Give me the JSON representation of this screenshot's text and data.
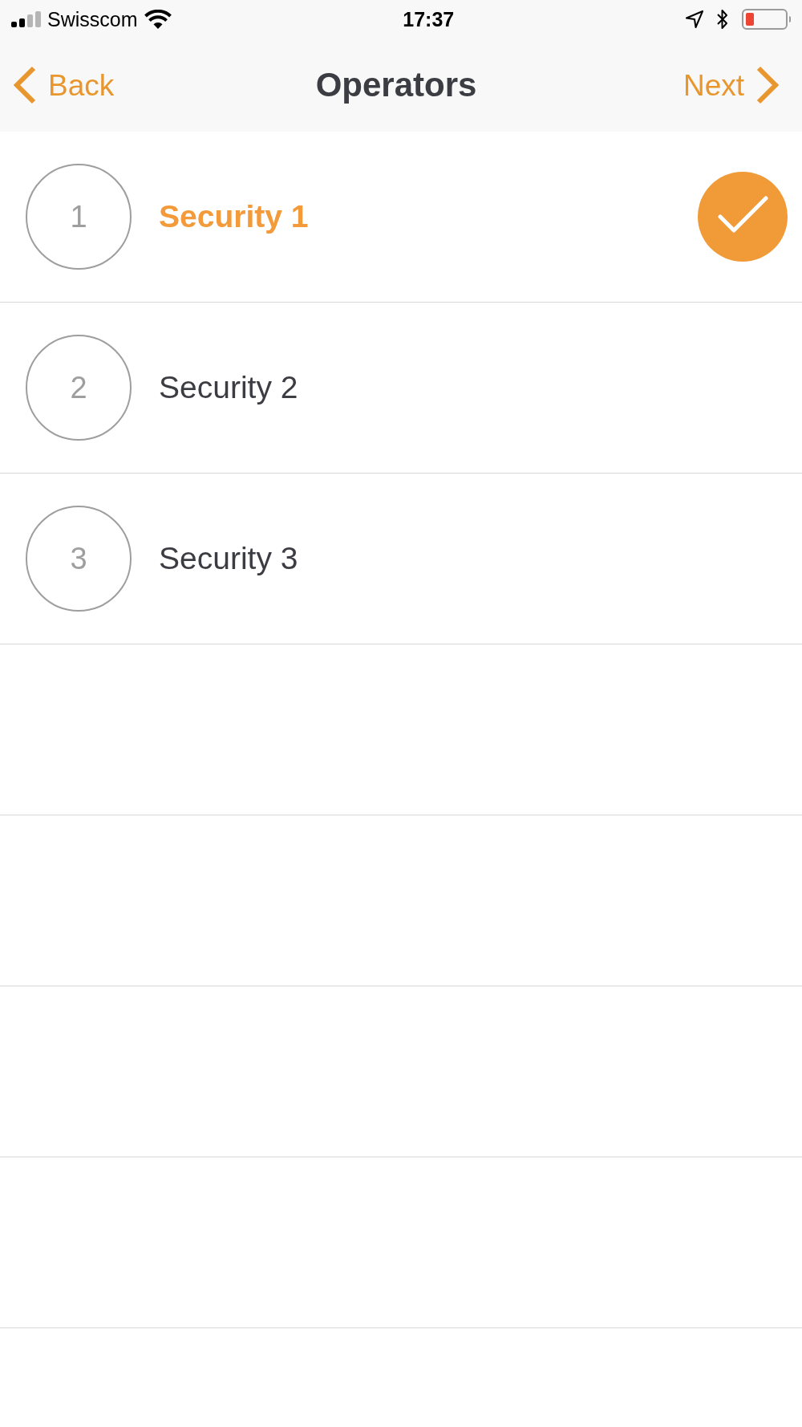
{
  "status_bar": {
    "carrier": "Swisscom",
    "time": "17:37"
  },
  "nav_bar": {
    "back": "Back",
    "title": "Operators",
    "next": "Next"
  },
  "operators": [
    {
      "number": "1",
      "name": "Security 1",
      "selected": true
    },
    {
      "number": "2",
      "name": "Security 2",
      "selected": false
    },
    {
      "number": "3",
      "name": "Security 3",
      "selected": false
    }
  ]
}
